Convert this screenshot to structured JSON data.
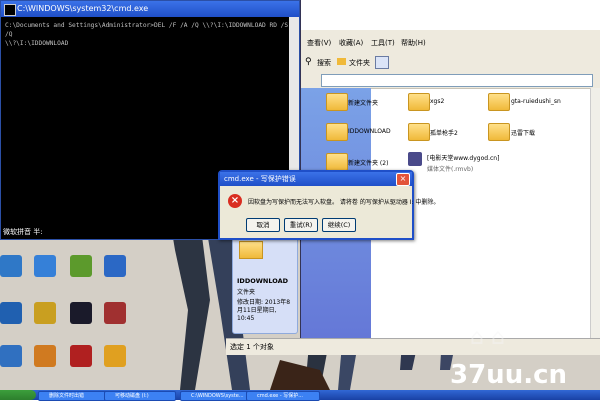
{
  "cmd": {
    "title": "C:\\WINDOWS\\system32\\cmd.exe",
    "lines": [
      "C:\\Documents and Settings\\Administrator>DEL /F /A /Q \\\\?\\I:\\IDDOWNLOAD  RD /S /Q",
      " \\\\?\\I:\\IDDOWNLOAD"
    ],
    "ime_text": "微软拼音 半:"
  },
  "explorer": {
    "menu": [
      "查看(V)",
      "收藏(A)",
      "工具(T)",
      "帮助(H)"
    ],
    "toolbar": {
      "search": "搜索",
      "folders": "文件夹"
    },
    "items": [
      {
        "label": "新建文件夹"
      },
      {
        "label": "xgs2"
      },
      {
        "label": "gta-ruiedushi_sn"
      },
      {
        "label": "IDDOWNLOAD"
      },
      {
        "label": "孤单枪手2"
      },
      {
        "label": "迅雷下载"
      },
      {
        "label": "新建文件夹 (2)"
      },
      {
        "label": "[电影天堂www.dygod.cn]",
        "sub": "媒体文件(.rmvb)"
      }
    ],
    "detail": {
      "name": "IDDOWNLOAD",
      "type": "文件夹",
      "modified_label": "修改日期: 2013年8月11日星期日, 10:45"
    },
    "status": "选定 1 个对象"
  },
  "dialog": {
    "title": "cmd.exe - 写保护错误",
    "message": "因软盘为写保护而无法写入软盘。 请将卷  的写保护从驱动器 I: 中删除。",
    "buttons": [
      "取消",
      "重试(R)",
      "继续(C)"
    ]
  },
  "taskbar": {
    "items": [
      "删除文件时出错",
      "可移动磁盘 (I:)",
      "C:\\WINDOWS\\syste...",
      "cmd.exe - 写保护..."
    ]
  },
  "watermark": "37uu.cn",
  "colors": {
    "titlebar_blue": "#1f4fc8",
    "dialog_bg": "#ece9d8",
    "explorer_leftpane": "#6b8ee0",
    "error_red": "#d92d20"
  }
}
